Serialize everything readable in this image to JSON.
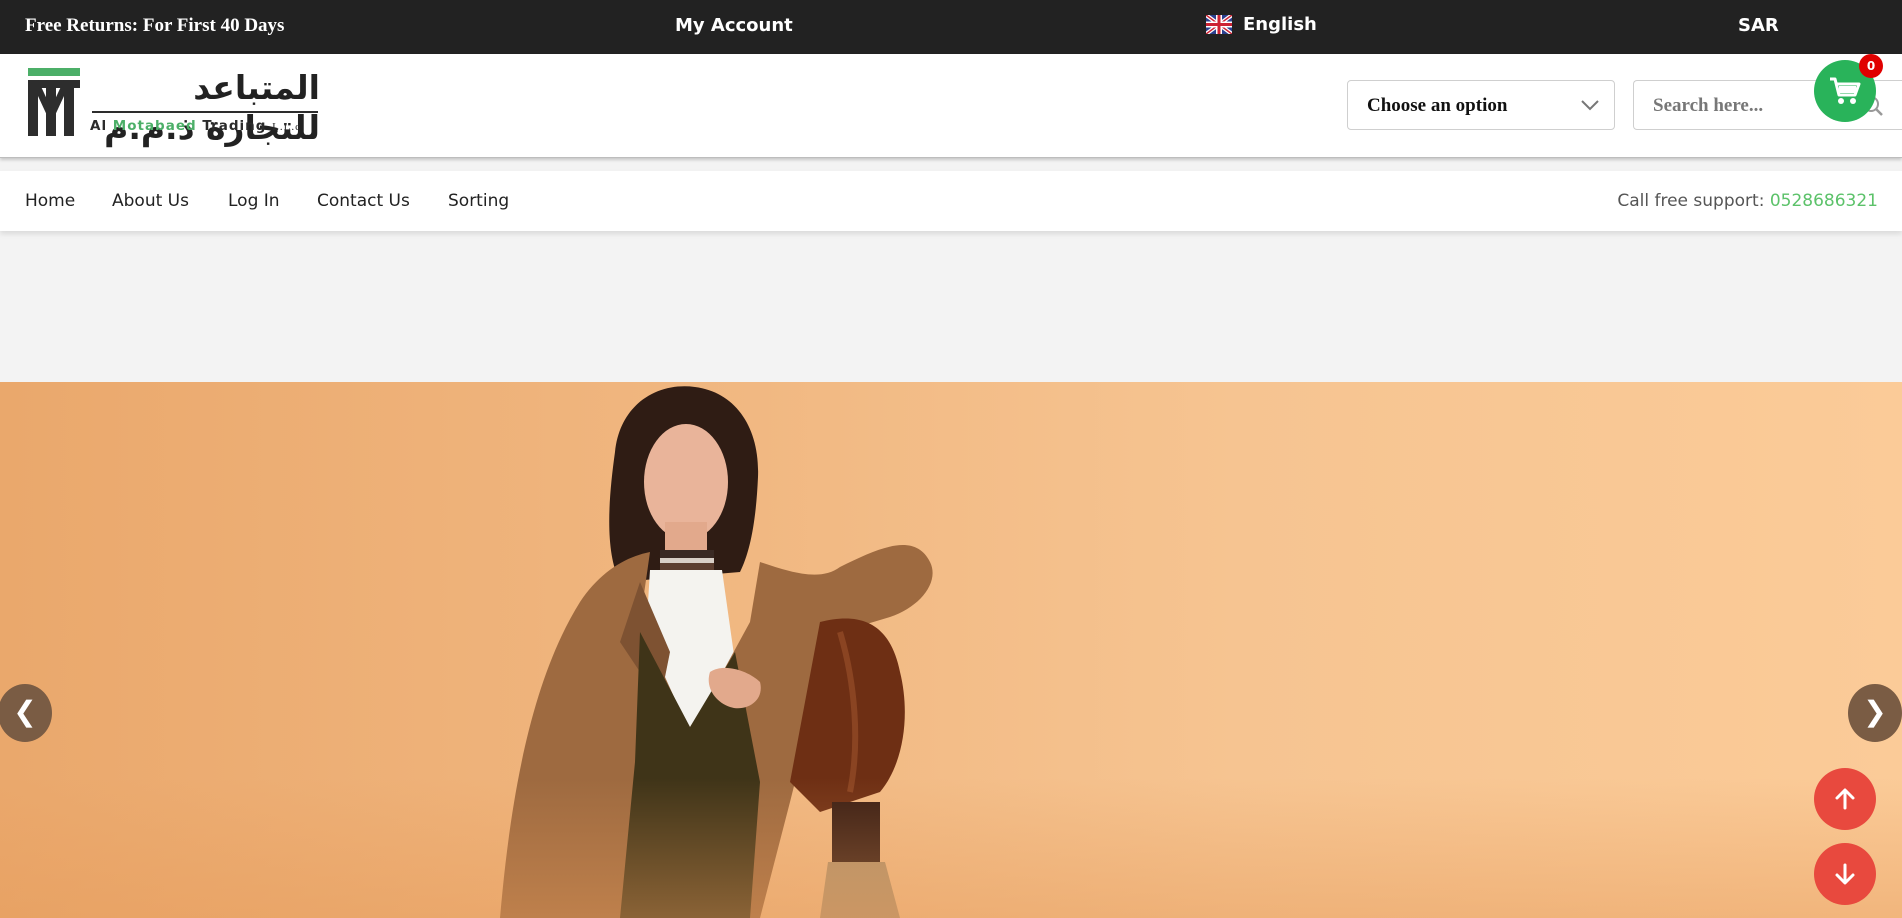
{
  "topbar": {
    "promo": "Free Returns: For First 40 Days",
    "account": "My Account",
    "language": "English",
    "currency": "SAR"
  },
  "header": {
    "logo": {
      "arabic": "المتباعد للتجارة ذ.م.م",
      "english_1": "Al ",
      "english_2": "Motabaed",
      "english_3": " Trading ",
      "english_4": "L.L.c"
    },
    "select": {
      "value": "Choose an option"
    },
    "search": {
      "placeholder": "Search here..."
    },
    "cart": {
      "count": "0"
    }
  },
  "nav": {
    "items": [
      "Home",
      "About Us",
      "Log In",
      "Contact Us",
      "Sorting"
    ],
    "support_label": "Call free support: ",
    "support_phone": "0528686321"
  },
  "hero": {
    "prev": "❮",
    "next": "❯"
  },
  "colors": {
    "topbar": "#222222",
    "green_accent": "#29b35a",
    "red_fab": "#e8493e",
    "hero_bg": "#f3bd88"
  }
}
